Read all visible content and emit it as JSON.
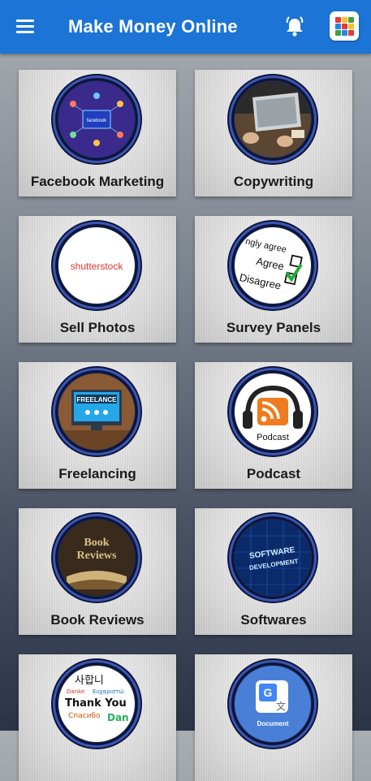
{
  "app": {
    "title": "Make Money Online"
  },
  "toolbar": {
    "menu_icon": "hamburger-menu-icon",
    "notify_icon": "bell-icon",
    "apps_icon": "apps-grid-icon"
  },
  "colors": {
    "appbar": "#1b74d6",
    "ring": "#3c55b5"
  },
  "cards": [
    {
      "label": "Facebook Marketing",
      "icon": "facebook-marketing-icon",
      "img_text": "facebook"
    },
    {
      "label": "Copywriting",
      "icon": "laptop-writing-icon"
    },
    {
      "label": "Sell Photos",
      "icon": "shutterstock-logo",
      "img_text": "shutterstock"
    },
    {
      "label": "Survey Panels",
      "icon": "survey-checklist-icon",
      "img_text": [
        "ngly agree",
        "Agree",
        "Disagree"
      ]
    },
    {
      "label": "Freelancing",
      "icon": "freelance-monitor-icon",
      "img_text": "FREELANCE"
    },
    {
      "label": "Podcast",
      "icon": "podcast-rss-icon",
      "img_text": "Podcast"
    },
    {
      "label": "Book Reviews",
      "icon": "book-reviews-icon",
      "img_text": [
        "Book",
        "Reviews"
      ]
    },
    {
      "label": "Softwares",
      "icon": "software-development-icon",
      "img_text": [
        "SOFTWARE",
        "DEVELOPMENT"
      ]
    },
    {
      "label": "",
      "icon": "translation-words-icon",
      "img_text": [
        "사합니",
        "Danke",
        "Ευχαριστώ",
        "Thank You",
        "Спасибо",
        "Dan"
      ]
    },
    {
      "label": "",
      "icon": "google-translate-icon",
      "img_text": "Document"
    }
  ]
}
